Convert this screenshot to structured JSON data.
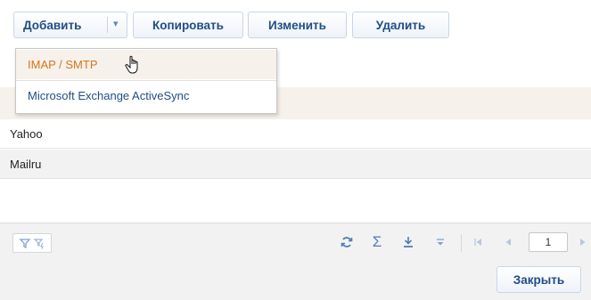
{
  "toolbar": {
    "add_label": "Добавить",
    "add_arrow": "▾",
    "copy_label": "Копировать",
    "edit_label": "Изменить",
    "delete_label": "Удалить"
  },
  "dropdown": {
    "items": [
      {
        "label": "IMAP / SMTP"
      },
      {
        "label": "Microsoft Exchange ActiveSync"
      }
    ]
  },
  "list": {
    "rows": [
      {
        "label": "Yahoo"
      },
      {
        "label": "Mailru"
      }
    ]
  },
  "pagination": {
    "current_page": "1"
  },
  "footer": {
    "close_label": "Закрыть"
  },
  "colors": {
    "accent": "#1f4d85",
    "highlight_text": "#d6771b",
    "highlight_bg": "#f6f1eb"
  }
}
